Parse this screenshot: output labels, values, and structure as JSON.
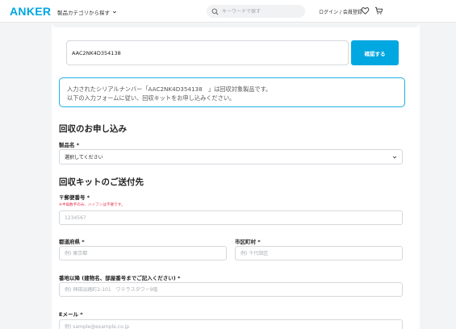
{
  "header": {
    "logo": "ANKER",
    "category_menu": "製品カテゴリから探す",
    "search_placeholder": "キーワードで探す",
    "login": "ログイン / 会員登録"
  },
  "serial": {
    "value": "AAC2NK4D354138",
    "confirm_button": "確認する"
  },
  "notice": {
    "line1": "入力されたシリアルナンバー「AAC2NK4D354138　」は回収対象製品です。",
    "line2": "以下の入力フォームに従い、回収キットをお申し込みください。"
  },
  "application": {
    "title": "回収のお申し込み",
    "product_label": "製品名 *",
    "product_select_value": "選択してください"
  },
  "shipping": {
    "title": "回収キットのご送付先",
    "postal_label": "〒郵便番号 *",
    "postal_hint": "※半角数字のみ、ハイフンは不要です。",
    "postal_placeholder": "1234567",
    "prefecture_label": "都道府県 *",
    "prefecture_placeholder": "例) 東京都",
    "city_label": "市区町村 *",
    "city_placeholder": "例) 千代田区",
    "address_label": "番地以降 (建物名、部屋番号までご記入ください) *",
    "address_placeholder": "例) 神田淡路町2-101　ワテラスタワー9階",
    "email_label": "Eメール *",
    "email_placeholder": "例) sample@example.co.jp"
  },
  "colors": {
    "brand": "#00a7e1",
    "notice_border": "#21b0e2",
    "hint_red": "#e0334c"
  },
  "icons": {
    "search": "search-icon",
    "chevron": "chevron-down-icon",
    "heart": "heart-icon",
    "cart": "cart-icon"
  }
}
